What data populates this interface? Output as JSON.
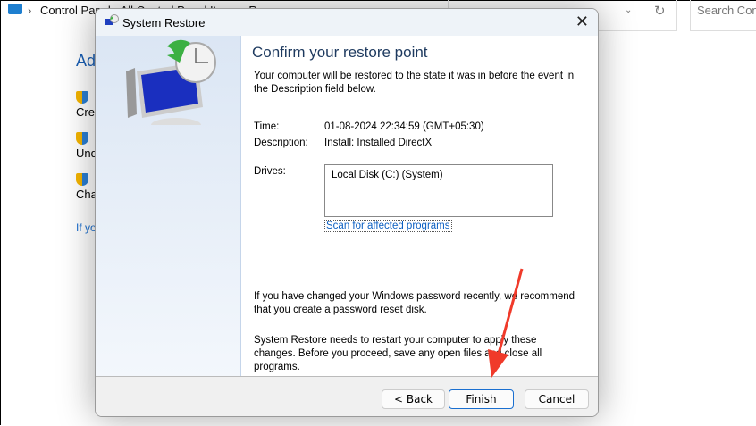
{
  "explorer": {
    "breadcrumb": "Control Panel  ›  All Control Panel Items  ›  Recovery",
    "search_placeholder": "Search Control Panel",
    "heading": "Adv",
    "items": [
      "Cre",
      "Und",
      "Cha"
    ],
    "footer_link": "If yo"
  },
  "dialog": {
    "title": "System Restore",
    "heading": "Confirm your restore point",
    "intro": "Your computer will be restored to the state it was in before the event in the Description field below.",
    "time_label": "Time:",
    "time_value": "01-08-2024 22:34:59 (GMT+05:30)",
    "description_label": "Description:",
    "description_value": "Install: Installed DirectX",
    "drives_label": "Drives:",
    "drives": [
      "Local Disk (C:) (System)"
    ],
    "scan_link": "Scan for affected programs",
    "password_note": "If you have changed your Windows password recently, we recommend that you create a password reset disk.",
    "restart_note": "System Restore needs to restart your computer to apply these changes. Before you proceed, save any open files and close all programs.",
    "back_label": "< Back",
    "finish_label": "Finish",
    "cancel_label": "Cancel"
  },
  "colors": {
    "accent": "#1a6fd0",
    "annotation_arrow": "#f03a2a"
  }
}
